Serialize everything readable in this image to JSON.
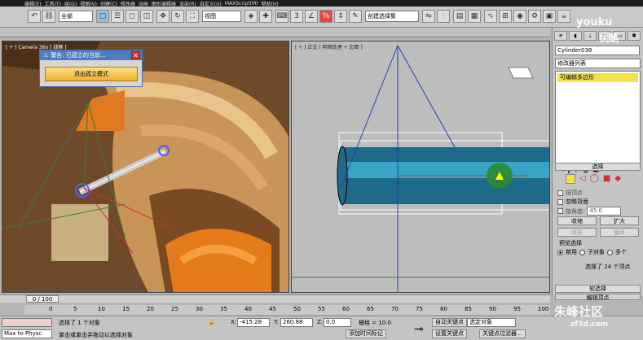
{
  "menu": [
    "编辑(E)",
    "工具(T)",
    "组(G)",
    "视图(V)",
    "创建(C)",
    "修改器",
    "动画",
    "图形编辑器",
    "渲染(R)",
    "自定义(U)",
    "MAXScript(M)",
    "帮助(H)"
  ],
  "toolbar": {
    "filter": "全部",
    "coord": "视图",
    "snap": "3",
    "named_sel": "创建选择集"
  },
  "viewport_left": {
    "label": "[ + ] Camera 36o [ 线框 ]"
  },
  "viewport_right": {
    "label": "[ + ] 正交 [ 明暗处理 + 边面 ]"
  },
  "dialog": {
    "title": "警告: 已孤立的当前...",
    "button": "退出孤立模式"
  },
  "panel": {
    "object_name": "Cylinder038",
    "modifier_list": "修改器列表",
    "stack_item": "可编辑多边形",
    "rollout_select": "选择",
    "by_vertex": "按顶点",
    "ignore_back": "忽略背面",
    "by_angle": "按角度:",
    "angle_value": "45.0",
    "shrink": "收缩",
    "grow": "扩大",
    "ring": "环形",
    "loop": "循环",
    "preview": "预览选择",
    "disable": "禁用",
    "subobject": "子对象",
    "multi": "多个",
    "selected_info": "选择了 24 个顶点",
    "soft_select": "软选择",
    "edit_vertex": "编辑顶点"
  },
  "timeline": {
    "frame": "0 / 100",
    "ticks": [
      "0",
      "5",
      "10",
      "15",
      "20",
      "25",
      "30",
      "35",
      "40",
      "45",
      "50",
      "55",
      "60",
      "65",
      "70",
      "75",
      "80",
      "85",
      "90",
      "95",
      "100"
    ]
  },
  "status": {
    "script": "Max to Physc",
    "selected": "选择了 1 个对象",
    "hint": "单击或单击并拖动以选择对象",
    "x_label": "X:",
    "x_value": "-415.28",
    "y_label": "Y:",
    "y_value": "260.88",
    "z_label": "Z:",
    "z_value": "0.0",
    "grid": "栅格 = 10.0",
    "add_tag": "添加时间标记",
    "autokey": "自动关键点",
    "setkey": "设置关键点",
    "sel_obj": "选定对象",
    "key_filter": "关键点过滤器..."
  },
  "watermark": {
    "youku": "youku",
    "youku_cn": "优酷",
    "brand": "朱峰社区",
    "url": "zf3d.com"
  },
  "colors": {
    "accent": "#f7e04c",
    "dialog_title": "#4c7dbf",
    "viewport_left_bg": "#6e4a2a",
    "viewport_right_bg": "#bdbdbd"
  }
}
